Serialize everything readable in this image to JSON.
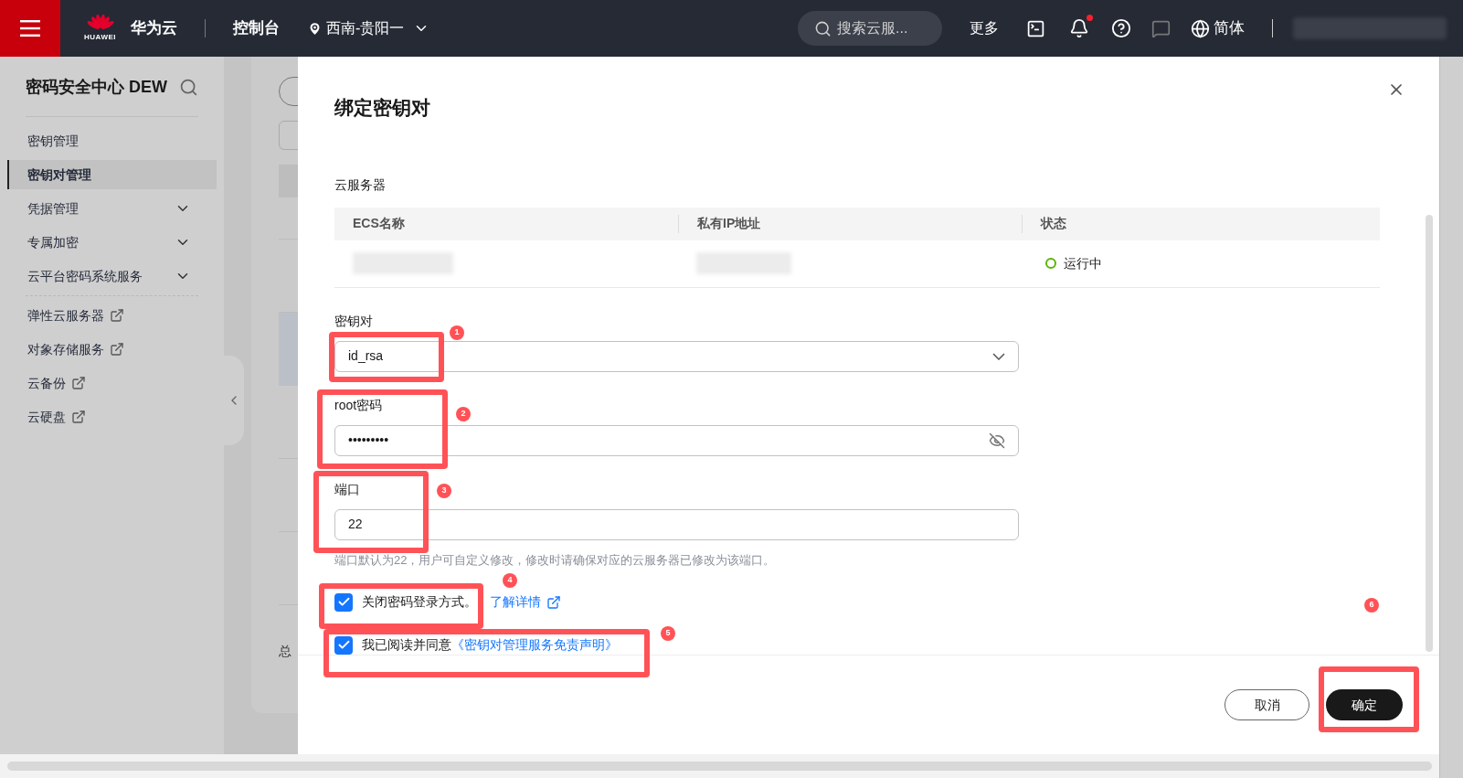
{
  "topbar": {
    "logo_text": "HUAWEI",
    "brand": "华为云",
    "console": "控制台",
    "region": "西南-贵阳一",
    "search": {
      "placeholder": "搜索云服..."
    },
    "more": "更多",
    "has_notification": true,
    "language": "简体"
  },
  "sidebar": {
    "title": "密码安全中心 DEW",
    "items": [
      {
        "label": "密钥管理",
        "kind": "link",
        "selected": false
      },
      {
        "label": "密钥对管理",
        "kind": "link",
        "selected": true
      },
      {
        "label": "凭据管理",
        "kind": "group",
        "selected": false
      },
      {
        "label": "专属加密",
        "kind": "group",
        "selected": false
      },
      {
        "label": "云平台密码系统服务",
        "kind": "group",
        "selected": false
      },
      {
        "label": "弹性云服务器",
        "kind": "external",
        "selected": false
      },
      {
        "label": "对象存储服务",
        "kind": "external",
        "selected": false
      },
      {
        "label": "云备份",
        "kind": "external",
        "selected": false
      },
      {
        "label": "云硬盘",
        "kind": "external",
        "selected": false
      }
    ]
  },
  "background": {
    "footer_text": "总"
  },
  "drawer": {
    "title": "绑定密钥对",
    "server_section": {
      "label": "云服务器",
      "columns": [
        "ECS名称",
        "私有IP地址",
        "状态"
      ],
      "rows": [
        {
          "status": "运行中"
        }
      ]
    },
    "fields": [
      {
        "kind": "select",
        "label": "密钥对",
        "value": "id_rsa"
      },
      {
        "kind": "password",
        "label": "root密码",
        "value": "•••••••••"
      },
      {
        "kind": "text",
        "label": "端口",
        "value": "22",
        "hint": "端口默认为22，用户可自定义修改，修改时请确保对应的云服务器已修改为该端口。"
      }
    ],
    "checkboxes": [
      {
        "checked": true,
        "text": "关闭密码登录方式。",
        "link": "了解详情",
        "kind": "external"
      },
      {
        "checked": true,
        "text": "我已阅读并同意",
        "link": "《密钥对管理服务免责声明》",
        "kind": "inline"
      }
    ],
    "buttons": [
      {
        "kind": "secondary",
        "label": "取消"
      },
      {
        "kind": "primary",
        "label": "确定"
      }
    ]
  },
  "annotations": [
    "1",
    "2",
    "3",
    "4",
    "5",
    "6"
  ]
}
